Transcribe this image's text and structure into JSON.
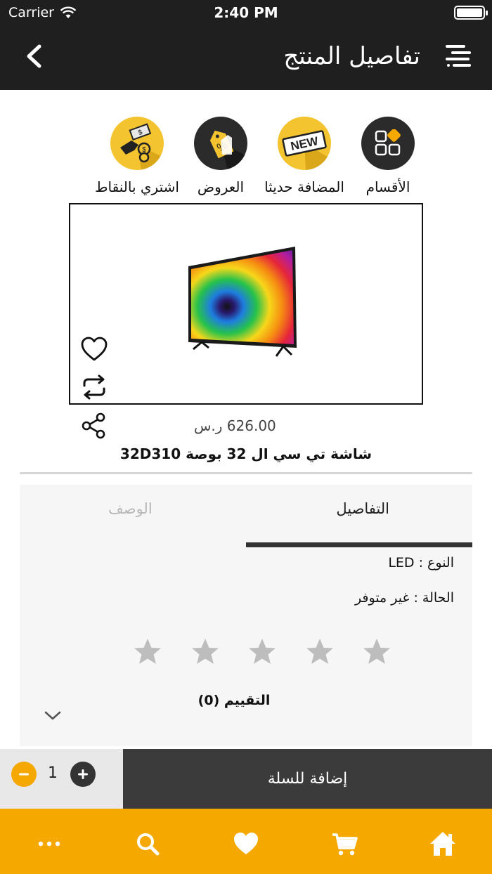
{
  "status_bar": {
    "carrier": "Carrier",
    "time": "2:40 PM"
  },
  "nav": {
    "title": "تفاصيل المنتج"
  },
  "quick_links": [
    {
      "label": "الأقسام",
      "icon": "categories-icon"
    },
    {
      "label": "المضافة حديثا",
      "icon": "new-badge-icon",
      "badge_text": "NEW"
    },
    {
      "label": "العروض",
      "icon": "discount-tag-icon"
    },
    {
      "label": "اشتري بالنقاط",
      "icon": "coins-hand-icon"
    }
  ],
  "product": {
    "price": "626.00 ر.س",
    "name": "شاشة تي سي ال 32 بوصة 32D310"
  },
  "details": {
    "tab_details": "التفاصيل",
    "tab_description": "الوصف",
    "type_line": "النوع : LED",
    "status_line": "الحالة : غير متوفر",
    "rating_label": "التقييم (0)",
    "rating_value": 0,
    "rating_max": 5
  },
  "cart": {
    "quantity": "1",
    "add_label": "إضافة للسلة"
  },
  "colors": {
    "accent": "#f4a800",
    "dark": "#1f1f1f",
    "button_dark": "#3b3b3b",
    "star_empty": "#bdbdbd"
  }
}
